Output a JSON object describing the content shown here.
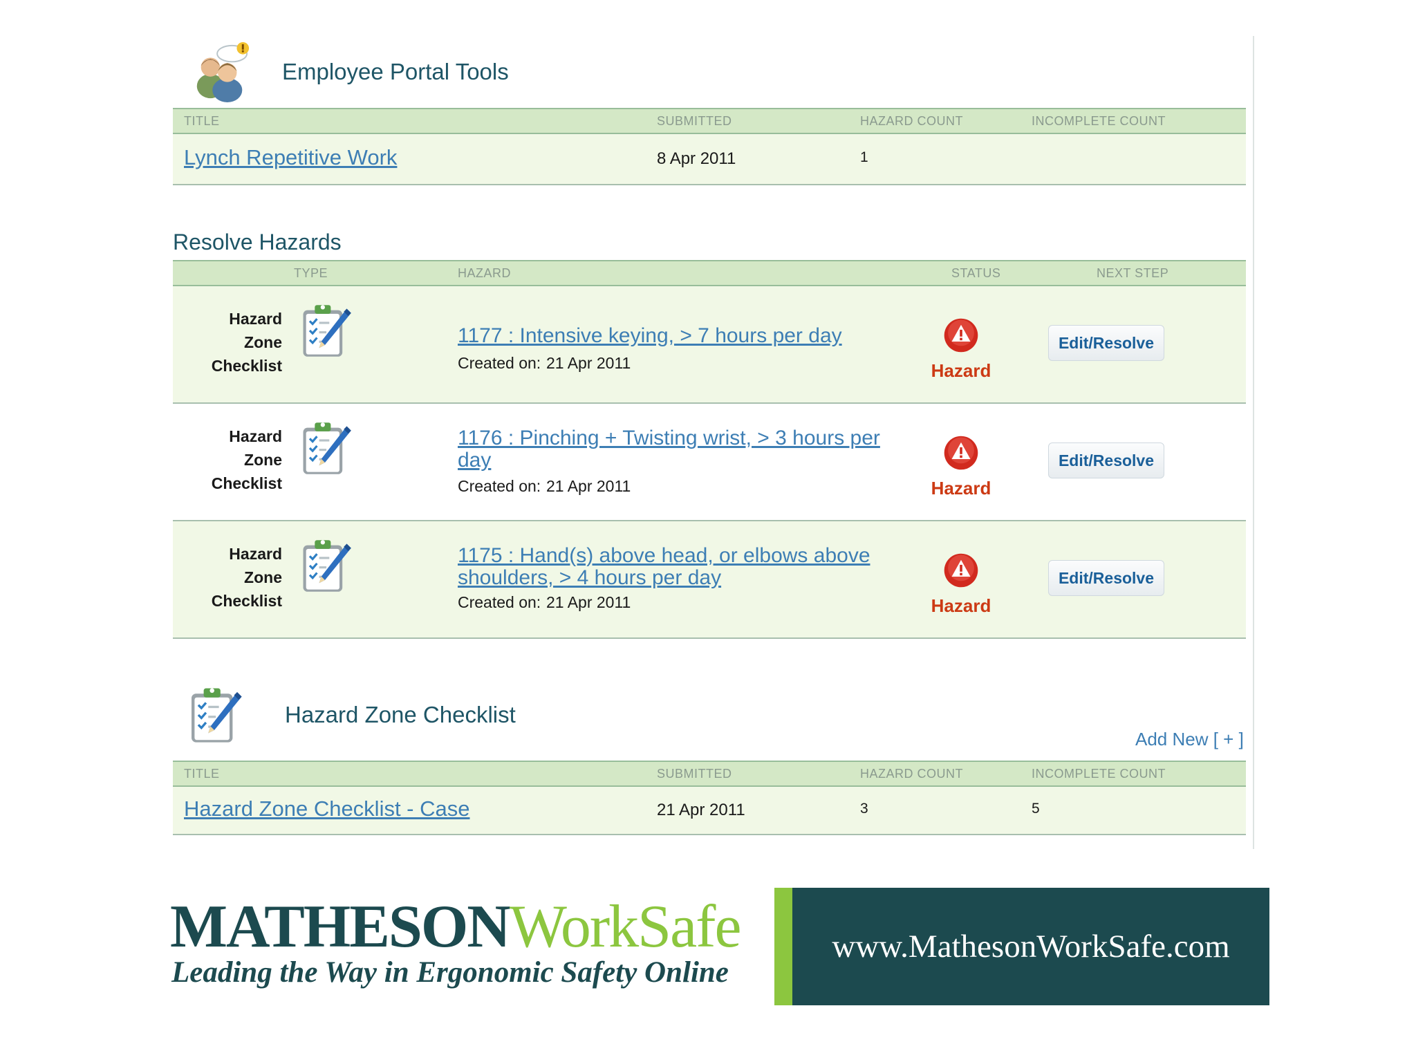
{
  "portal": {
    "title": "Employee Portal Tools",
    "icon": "users-alert-icon",
    "columns": [
      "TITLE",
      "SUBMITTED",
      "HAZARD COUNT",
      "INCOMPLETE COUNT"
    ],
    "rows": [
      {
        "title": "Lynch Repetitive Work",
        "submitted": "8 Apr 2011",
        "hazard_count": "1",
        "incomplete_count": ""
      }
    ]
  },
  "resolve": {
    "title": "Resolve Hazards",
    "columns": [
      "TYPE",
      "HAZARD",
      "STATUS",
      "NEXT STEP"
    ],
    "rows": [
      {
        "type_line1": "Hazard",
        "type_line2": "Zone",
        "type_line3": "Checklist",
        "hazard": "1177 : Intensive keying, > 7 hours per day",
        "created_label": "Created on:",
        "created_date": "21 Apr 2011",
        "status": "Hazard",
        "action": "Edit/Resolve"
      },
      {
        "type_line1": "Hazard",
        "type_line2": "Zone",
        "type_line3": "Checklist",
        "hazard": "1176 : Pinching + Twisting wrist, > 3 hours per day",
        "created_label": "Created on:",
        "created_date": "21 Apr 2011",
        "status": "Hazard",
        "action": "Edit/Resolve"
      },
      {
        "type_line1": "Hazard",
        "type_line2": "Zone",
        "type_line3": "Checklist",
        "hazard": "1175 : Hand(s) above head, or elbows above shoulders, > 4 hours per day",
        "created_label": "Created on:",
        "created_date": "21 Apr 2011",
        "status": "Hazard",
        "action": "Edit/Resolve"
      }
    ]
  },
  "checklist": {
    "title": "Hazard Zone Checklist",
    "add_new": "Add New [ + ]",
    "columns": [
      "TITLE",
      "SUBMITTED",
      "HAZARD COUNT",
      "INCOMPLETE COUNT"
    ],
    "rows": [
      {
        "title": "Hazard Zone Checklist - Case",
        "submitted": "21 Apr 2011",
        "hazard_count": "3",
        "incomplete_count": "5"
      }
    ]
  },
  "brand": {
    "name_part1": "MATHESON",
    "name_part2": "WorkSafe",
    "tagline": "Leading the Way in Ergonomic Safety Online",
    "url": "www.MathesonWorkSafe.com"
  },
  "colors": {
    "header_bg": "#d4e8c6",
    "row_bg": "#f1f8e6",
    "link": "#3d7eb4",
    "title": "#1e5566",
    "hazard_red": "#cc3a14",
    "brand_dark": "#1c4a4f",
    "brand_green": "#8cc63f"
  }
}
